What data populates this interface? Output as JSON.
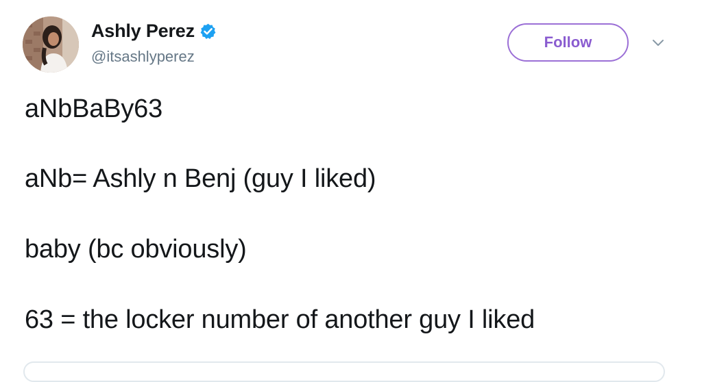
{
  "tweet": {
    "author": {
      "name": "Ashly Perez",
      "handle": "@itsashlyperez",
      "verified": true
    },
    "follow_label": "Follow",
    "lines": [
      "aNbBaBy63",
      "aNb= Ashly n Benj (guy I liked)",
      "baby (bc obviously)",
      "63 = the locker number of another guy I liked"
    ]
  },
  "colors": {
    "accent": "#8a5cd0",
    "verified_badge": "#1da1f2",
    "handle_text": "#657786",
    "body_text": "#14171a"
  },
  "icons": {
    "verified": "verified-badge-icon",
    "menu": "chevron-down-icon"
  }
}
